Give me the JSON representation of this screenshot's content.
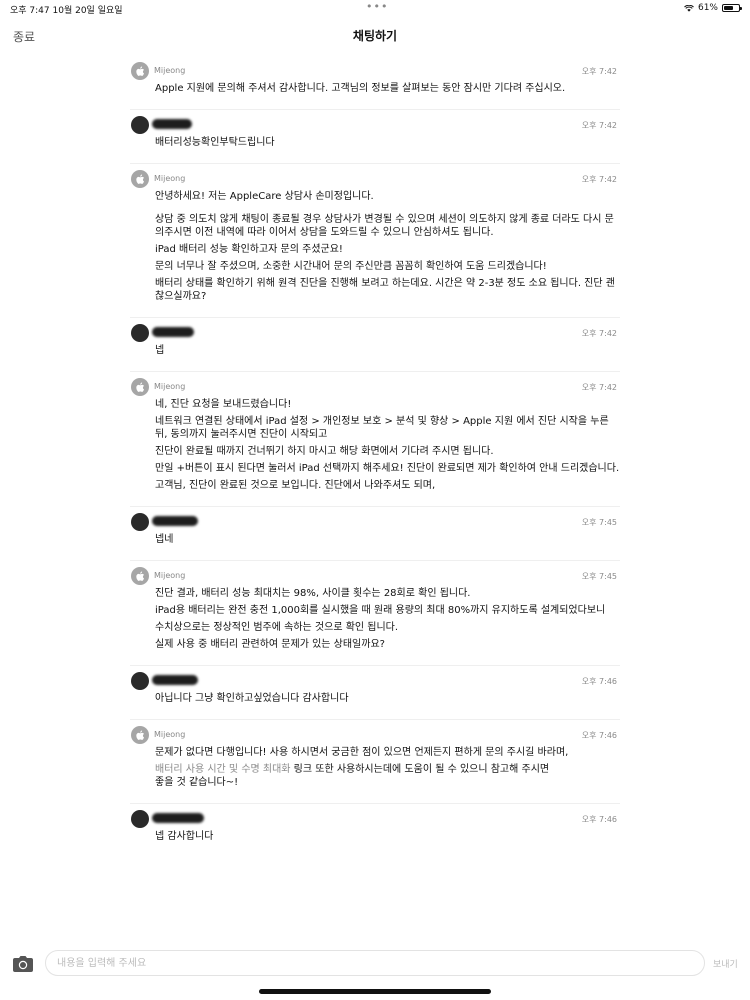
{
  "status_bar": {
    "time": "오후 7:47",
    "date": "10월 20일 일요일",
    "battery_text": "61%",
    "battery_level": 0.61
  },
  "nav": {
    "close_label": "종료",
    "title": "채팅하기"
  },
  "messages": [
    {
      "sender": "Mijeong",
      "time": "오후 7:42",
      "paragraphs": [
        "Apple 지원에 문의해 주셔서 감사합니다. 고객님의 정보를 살펴보는 동안 잠시만 기다려 주십시오."
      ]
    },
    {
      "sender": "",
      "time": "오후 7:42",
      "paragraphs": [
        "배터리성능확인부탁드립니다"
      ]
    },
    {
      "sender": "Mijeong",
      "time": "오후 7:42",
      "paragraphs": [
        "안녕하세요! 저는 AppleCare 상담사 손미정입니다.",
        "상담 중 의도치 않게 채팅이 종료될 경우 상담사가 변경될 수 있으며 세션이 의도하지 않게 종료 더라도 다시 문의주시면 이전 내역에 따라 이어서 상담을 도와드릴 수 있으니 안심하셔도 됩니다.",
        "iPad 배터리 성능 확인하고자 문의 주셨군요!",
        "문의 너무나 잘 주셨으며, 소중한 시간내어 문의 주신만큼 꼼꼼히 확인하여 도움 드리겠습니다!",
        "배터리 상태를 확인하기 위해 원격 진단을 진행해 보려고 하는데요. 시간은 약 2-3분 정도 소요 됩니다. 진단 괜찮으실까요?"
      ]
    },
    {
      "sender": "",
      "time": "오후 7:42",
      "paragraphs": [
        "넵"
      ]
    },
    {
      "sender": "Mijeong",
      "time": "오후 7:42",
      "paragraphs": [
        "네, 진단 요청을 보내드렸습니다!",
        "네트워크 연결된 상태에서 iPad  설정 > 개인정보 보호 > 분석 및 향상 > Apple 지원 에서 진단 시작을 누른 뒤, 동의까지 눌러주시면 진단이 시작되고",
        "진단이 완료될 때까지 건너뛰기 하지 마시고 해당 화면에서 기다려 주시면 됩니다.",
        "만일 +버튼이 표시 된다면 눌러서 iPad  선택까지 해주세요! 진단이 완료되면 제가 확인하여 안내 드리겠습니다.",
        "고객님, 진단이 완료된 것으로 보입니다. 진단에서 나와주셔도 되며,"
      ]
    },
    {
      "sender": "",
      "time": "오후 7:45",
      "paragraphs": [
        "넵네"
      ]
    },
    {
      "sender": "Mijeong",
      "time": "오후 7:45",
      "paragraphs": [
        "진단 결과, 배터리 성능 최대치는 98%, 사이클 횟수는 28회로 확인 됩니다.",
        "iPad용 배터리는 완전 충전 1,000회를 실시했을 때 원래 용량의 최대 80%까지 유지하도록 설계되었다보니",
        "수치상으로는 정상적인 범주에 속하는 것으로 확인 됩니다.",
        "실제 사용 중 배터리 관련하여 문제가 있는 상태일까요?"
      ]
    },
    {
      "sender": "",
      "time": "오후 7:46",
      "paragraphs": [
        "아닙니다 그냥 확인하고싶었습니다 감사합니다"
      ]
    },
    {
      "sender": "Mijeong",
      "time": "오후 7:46",
      "paragraphs": [
        "문제가 없다면 다행입니다! 사용 하시면서 궁금한 점이 있으면 언제든지 편하게 문의 주시길 바라며,",
        "좋을 것 같습니다~!"
      ],
      "link_text": "배터리 사용 시간 및 수명 최대화",
      "link_suffix": "  링크 또한 사용하시는데에 도움이 될 수 있으니 참고해 주시면"
    },
    {
      "sender": "",
      "time": "오후 7:46",
      "paragraphs": [
        "넵 감사합니다"
      ]
    }
  ],
  "composer": {
    "placeholder": "내용을 입력해 주세요",
    "send_label": "보내기"
  }
}
